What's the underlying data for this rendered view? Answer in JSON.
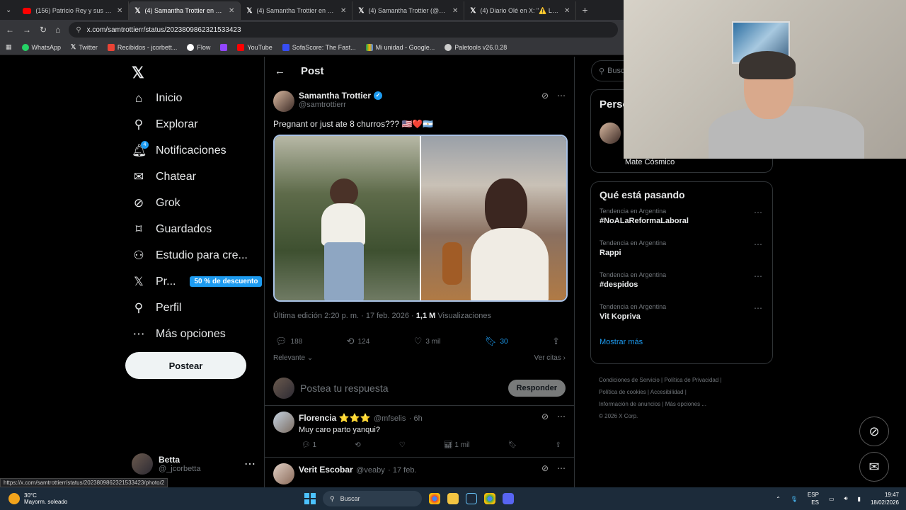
{
  "browser": {
    "tabs": [
      {
        "label": "(156) Patricio Rey y sus Redondi",
        "icon": "youtube"
      },
      {
        "label": "(4) Samantha Trottier en X: \"Pre",
        "icon": "x"
      },
      {
        "label": "(4) Samantha Trottier en X: \"Gra",
        "icon": "x"
      },
      {
        "label": "(4) Samantha Trottier (@samtro",
        "icon": "x"
      },
      {
        "label": "(4) Diario Olé en X: \"⚠️ La defe",
        "icon": "x"
      }
    ],
    "url": "x.com/samtrottierr/status/2023809862321533423",
    "bookmarks": [
      "WhatsApp",
      "Twitter",
      "Recibidos - jcorbett...",
      "Flow",
      "",
      "YouTube",
      "SofaScore: The Fast...",
      "Mi unidad - Google...",
      "Paletools v26.0.28"
    ],
    "status_url": "https://x.com/samtrottierr/status/2023809862321533423/photo/2"
  },
  "sidebar": {
    "items": [
      {
        "label": "Inicio",
        "icon": "home-icon"
      },
      {
        "label": "Explorar",
        "icon": "search-icon"
      },
      {
        "label": "Notificaciones",
        "icon": "bell-icon",
        "badge": "4"
      },
      {
        "label": "Chatear",
        "icon": "mail-icon"
      },
      {
        "label": "Grok",
        "icon": "grok-icon"
      },
      {
        "label": "Guardados",
        "icon": "bookmark-icon"
      },
      {
        "label": "Estudio para cre...",
        "icon": "creator-icon"
      },
      {
        "label": "Pr...",
        "icon": "x-icon",
        "promo": "50 % de descuento"
      },
      {
        "label": "Perfil",
        "icon": "person-icon"
      },
      {
        "label": "Más opciones",
        "icon": "more-icon"
      }
    ],
    "post_button": "Postear",
    "account": {
      "name": "Betta",
      "handle": "@_jcorbetta"
    }
  },
  "post": {
    "header": "Post",
    "author": {
      "name": "Samantha Trottier",
      "handle": "@samtrottierr"
    },
    "text": "Pregnant or just ate 8 churros??? 🇺🇸❤️🇦🇷",
    "edited": "Última edición 2:20 p. m. · 17 feb. 2026 ·",
    "views_count": "1,1 M",
    "views_label": "Visualizaciones",
    "stats": {
      "replies": "188",
      "reposts": "124",
      "likes": "3 mil",
      "bookmarks": "30"
    },
    "sort_label": "Relevante",
    "quotes_label": "Ver citas",
    "reply_placeholder": "Postea tu respuesta",
    "reply_button": "Responder"
  },
  "replies": [
    {
      "name": "Florencia ⭐⭐⭐",
      "handle": "@mfselis",
      "time": "· 6h",
      "text": "Muy caro parto yanqui?",
      "reply_count": "1",
      "views": "1 mil"
    },
    {
      "name": "Verit Escobar",
      "handle": "@veaby",
      "time": "· 17 feb.",
      "text": ""
    }
  ],
  "right": {
    "search_placeholder": "Busc",
    "people_title": "Perso",
    "people_name": "Mate Cósmico",
    "trends_title": "Qué está pasando",
    "trends": [
      {
        "context": "Tendencia en Argentina",
        "name": "#NoALaReformaLaboral"
      },
      {
        "context": "Tendencia en Argentina",
        "name": "Rappi"
      },
      {
        "context": "Tendencia en Argentina",
        "name": "#despidos"
      },
      {
        "context": "Tendencia en Argentina",
        "name": "Vit Kopriva"
      }
    ],
    "show_more": "Mostrar más",
    "footer": [
      "Condiciones de Servicio",
      "Política de Privacidad",
      "Política de cookies",
      "Accesibilidad",
      "Información de anuncios",
      "Más opciones ...",
      "© 2026 X Corp."
    ]
  },
  "taskbar": {
    "temp": "30°C",
    "weather": "Mayorm. soleado",
    "search": "Buscar",
    "lang1": "ESP",
    "lang2": "ES",
    "time": "19:47",
    "date": "18/02/2026"
  },
  "colors": {
    "accent": "#1d9bf0",
    "bg": "#000000",
    "border": "#2f3336"
  }
}
